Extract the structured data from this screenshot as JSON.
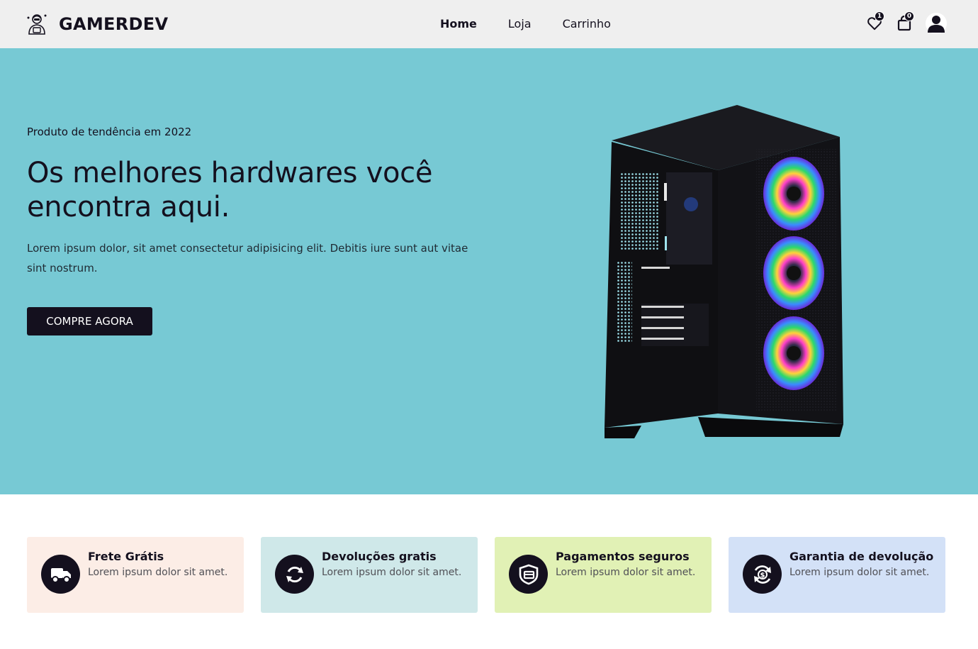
{
  "header": {
    "brand": "GAMERDEV",
    "nav": [
      "Home",
      "Loja",
      "Carrinho"
    ],
    "active_nav": "Home",
    "wishlist_count": "1",
    "cart_count": "0",
    "icons": [
      "avatar-logo-icon",
      "heart-icon",
      "shopping-bag-icon",
      "user-icon"
    ]
  },
  "hero": {
    "eyebrow": "Produto de tendência em 2022",
    "title": "Os melhores hardwares você encontra aqui.",
    "text": "Lorem ipsum dolor, sit amet consectetur adipisicing elit. Debitis iure sunt aut vitae sint nostrum.",
    "cta": "COMPRE AGORA",
    "background_color": "#77c9d4"
  },
  "features": [
    {
      "title": "Frete Grátis",
      "text": "Lorem ipsum dolor sit amet.",
      "icon": "truck-icon",
      "color": "#fcede6"
    },
    {
      "title": "Devoluções gratis",
      "text": "Lorem ipsum dolor sit amet.",
      "icon": "refresh-icon",
      "color": "#cfe8e9"
    },
    {
      "title": "Pagamentos seguros",
      "text": "Lorem ipsum dolor sit amet.",
      "icon": "secure-payment-icon",
      "color": "#e1f1b5"
    },
    {
      "title": "Garantia de devolução",
      "text": "Lorem ipsum dolor sit amet.",
      "icon": "money-back-icon",
      "color": "#d3e1f7"
    }
  ],
  "colors": {
    "dark": "#14101e",
    "nav_bg": "#efefef"
  }
}
